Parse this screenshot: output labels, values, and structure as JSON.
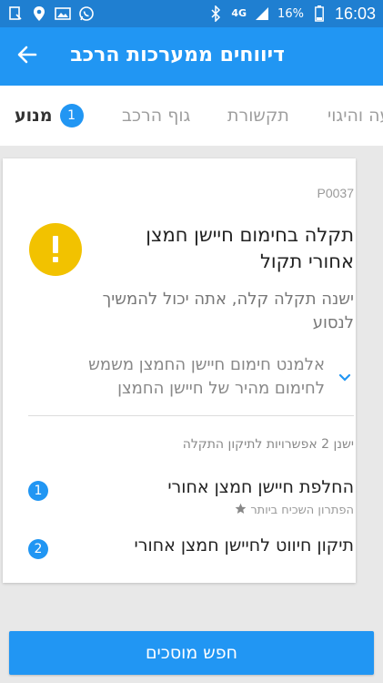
{
  "status_bar": {
    "time": "16:03",
    "battery": "16%",
    "network": "4G",
    "left_icons": [
      "device-icon",
      "location-icon",
      "image-icon",
      "whatsapp-icon"
    ],
    "right_icons": [
      "bluetooth-icon",
      "signal-icon",
      "battery-icon"
    ]
  },
  "app_bar": {
    "title": "דיווחים ממערכות הרכב",
    "back_icon": "arrow-left-icon"
  },
  "tabs": [
    {
      "number": "1",
      "label": "מנוע",
      "active": true
    },
    {
      "label": "גוף הרכב",
      "active": false
    },
    {
      "label": "תקשורת",
      "active": false
    },
    {
      "label": "הנעה והיגוי",
      "active": false
    }
  ],
  "card": {
    "code": "P0037",
    "headline": "תקלה בחימום חיישן חמצן אחורי תקול",
    "subtext": "ישנה תקלה קלה, אתה יכול להמשיך לנסוע",
    "expand_text": "אלמנט חימום חיישן החמצן משמש לחימום מהיר של חיישן החמצן",
    "fix_count": "ישנן 2 אפשרויות לתיקון התקלה",
    "options": [
      {
        "number": "1",
        "title": "החלפת חיישן חמצן אחורי",
        "subtitle": "הפתרון השכיח ביותר"
      },
      {
        "number": "2",
        "title": "תיקון חיווט לחיישן חמצן אחורי"
      }
    ]
  },
  "bottom": {
    "button_label": "חפש מוסכים"
  },
  "colors": {
    "primary": "#2196f3",
    "status_bar": "#1f7fd1",
    "warning": "#f2c200"
  }
}
